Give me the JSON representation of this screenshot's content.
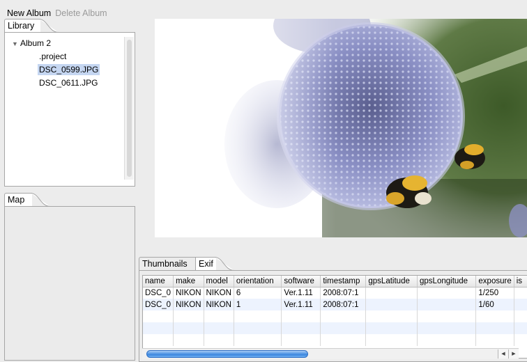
{
  "toolbar": {
    "new_album": "New Album",
    "delete_album": "Delete Album"
  },
  "library": {
    "tab_label": "Library",
    "album_name": "Album 2",
    "files": [
      ".project",
      "DSC_0599.JPG",
      "DSC_0611.JPG"
    ],
    "selected_file": "DSC_0599.JPG"
  },
  "map": {
    "tab_label": "Map"
  },
  "bottom": {
    "tabs": [
      "Thumbnails",
      "Exif"
    ],
    "active_tab": "Exif"
  },
  "exif": {
    "columns": [
      "name",
      "make",
      "model",
      "orientation",
      "software",
      "timestamp",
      "gpsLatitude",
      "gpsLongitude",
      "exposure",
      "is"
    ],
    "rows": [
      [
        "DSC_0",
        "NIKON",
        "NIKON",
        "6",
        "Ver.1.11",
        "2008:07:1",
        "",
        "",
        "1/250",
        ""
      ],
      [
        "DSC_0",
        "NIKON",
        "NIKON",
        "1",
        "Ver.1.11",
        "2008:07:1",
        "",
        "",
        "1/60",
        ""
      ],
      [
        "",
        "",
        "",
        "",
        "",
        "",
        "",
        "",
        "",
        ""
      ],
      [
        "",
        "",
        "",
        "",
        "",
        "",
        "",
        "",
        "",
        ""
      ],
      [
        "",
        "",
        "",
        "",
        "",
        "",
        "",
        "",
        "",
        ""
      ]
    ]
  },
  "colors": {
    "selection": "#c5d6f1",
    "scroll_thumb": "#3b86df",
    "row_alt": "#edf3fe",
    "flower_purple": "#8a8fc4"
  }
}
